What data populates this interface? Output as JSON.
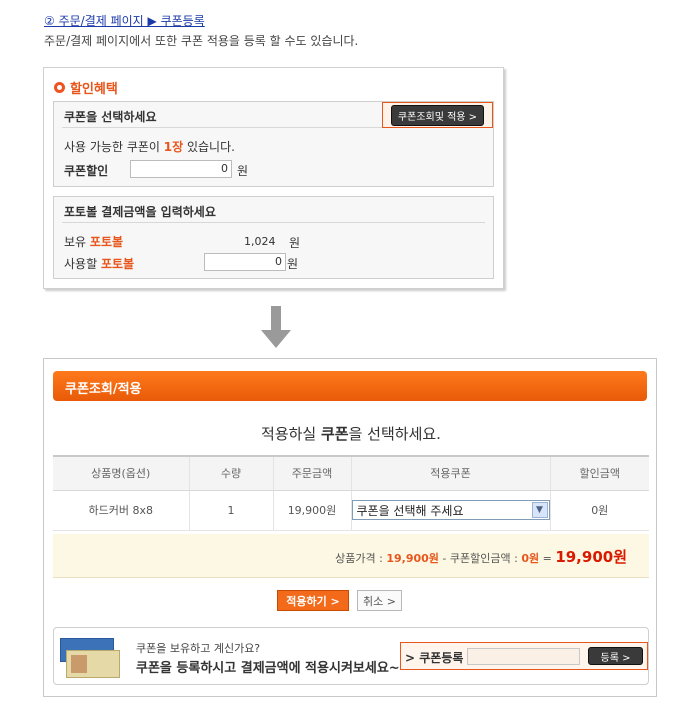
{
  "step": {
    "link": "② 주문/결제 페이지 ▶ 쿠폰등록",
    "desc": "주문/결제 페이지에서 또한 쿠폰 적용을 등록 할 수도 있습니다."
  },
  "discount_panel": {
    "title": "할인혜택",
    "coupon_section": {
      "heading": "쿠폰을 선택하세요",
      "lookup_button": "쿠폰조회및 적용 >",
      "available_prefix": "사용 가능한 쿠폰이 ",
      "available_count": "1장",
      "available_suffix": " 있습니다.",
      "discount_label": "쿠폰할인",
      "discount_value": "0",
      "discount_unit": "원"
    },
    "photoball_section": {
      "heading": "포토볼 결제금액을 입력하세요",
      "own_label_prefix": "보유 ",
      "own_label_brand": "포토볼",
      "own_value": "1,024",
      "own_unit": "원",
      "use_label_prefix": "사용할 ",
      "use_label_brand": "포토볼",
      "use_value": "0",
      "use_unit": "원"
    }
  },
  "popup": {
    "title": "쿠폰조회/적용",
    "heading_prefix": "적용하실 ",
    "heading_bold": "쿠폰",
    "heading_suffix": "을 선택하세요.",
    "table": {
      "headers": [
        "상품명(옵션)",
        "수량",
        "주문금액",
        "적용쿠폰",
        "할인금액"
      ],
      "row": {
        "product": "하드커버 8x8",
        "qty": "1",
        "amount": "19,900원",
        "coupon_select": "쿠폰을 선택해 주세요",
        "discount": "0원"
      }
    },
    "summary": {
      "price_label": "상품가격 : ",
      "price_value": "19,900원",
      "minus": " - 쿠폰할인금액 : ",
      "coupon_value": "0원",
      "equals": " = ",
      "total": "19,900원"
    },
    "apply_button": "적용하기 >",
    "cancel_button": "취소 >",
    "register": {
      "line1": "쿠폰을 보유하고 계신가요?",
      "line2": "쿠폰을 등록하시고 결제금액에 적용시켜보세요~",
      "label": "> 쿠폰등록",
      "button": "등록 >"
    }
  },
  "colors": {
    "accent": "#e8561c",
    "header_bar": "#f26a1a",
    "summary_bg": "#fdf8e3"
  }
}
